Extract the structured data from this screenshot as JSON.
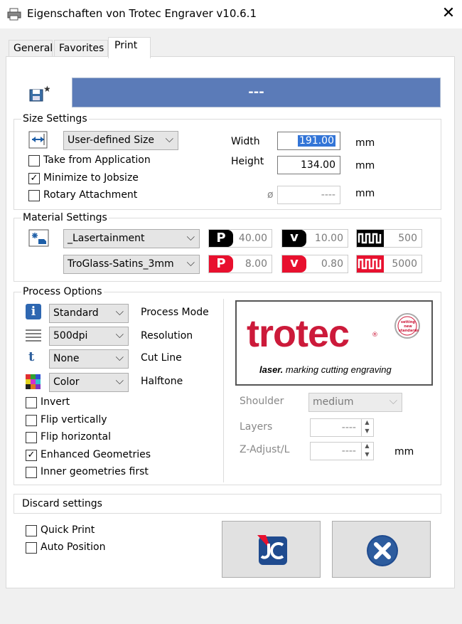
{
  "window": {
    "title": "Eigenschaften von Trotec Engraver v10.6.1",
    "close_glyph": "✕"
  },
  "tabs": [
    {
      "label": "General"
    },
    {
      "label": "Favorites"
    },
    {
      "label": "Print"
    }
  ],
  "job_bar": {
    "text": "---",
    "color": "#5b7bb8"
  },
  "size_settings": {
    "title": "Size Settings",
    "size_combo": "User-defined Size",
    "take_from_application": {
      "label": "Take from Application",
      "checked": false
    },
    "minimize_to_jobsize": {
      "label": "Minimize to Jobsize",
      "checked": true
    },
    "rotary_attachment": {
      "label": "Rotary Attachment",
      "checked": false
    },
    "width_label": "Width",
    "width_value": "191.00",
    "height_label": "Height",
    "height_value": "134.00",
    "diameter_symbol": "ø",
    "diameter_value": "----",
    "unit": "mm"
  },
  "material_settings": {
    "title": "Material Settings",
    "material_group": "_Lasertainment",
    "material": "TroGlass-Satins_3mm",
    "engrave": {
      "power": "40.00",
      "velocity": "10.00",
      "ppi": "500",
      "p_glyph": "P",
      "v_glyph": "v"
    },
    "cut": {
      "power": "8.00",
      "velocity": "0.80",
      "hz": "5000",
      "p_glyph": "P",
      "v_glyph": "v"
    }
  },
  "process_options": {
    "title": "Process Options",
    "process_mode": {
      "value": "Standard",
      "label": "Process Mode",
      "icon_glyph": "i"
    },
    "resolution": {
      "value": "500dpi",
      "label": "Resolution"
    },
    "cut_line": {
      "value": "None",
      "label": "Cut Line",
      "icon_glyph": "t"
    },
    "halftone": {
      "value": "Color",
      "label": "Halftone"
    },
    "invert": {
      "label": "Invert",
      "checked": false
    },
    "flip_vertically": {
      "label": "Flip vertically",
      "checked": false
    },
    "flip_horizontal": {
      "label": "Flip horizontal",
      "checked": false
    },
    "enhanced_geometries": {
      "label": "Enhanced Geometries",
      "checked": true
    },
    "inner_geometries_first": {
      "label": "Inner geometries first",
      "checked": false
    },
    "logo": {
      "brand": "trotec",
      "tagline_bold": "laser.",
      "tagline": " marking cutting engraving",
      "seal_text": "setting new standards",
      "reg_mark": "®"
    },
    "shoulder": {
      "label": "Shoulder",
      "value": "medium"
    },
    "layers": {
      "label": "Layers",
      "value": "----"
    },
    "z_adjust": {
      "label": "Z-Adjust/L",
      "value": "----",
      "unit": "mm"
    }
  },
  "discard_settings": {
    "label": "Discard settings"
  },
  "footer": {
    "quick_print": {
      "label": "Quick Print",
      "checked": false
    },
    "auto_position": {
      "label": "Auto Position",
      "checked": false
    }
  },
  "glyphs": {
    "check": "✓",
    "chevron": "⌵",
    "up": "▲",
    "down": "▼"
  },
  "colors": {
    "accent_blue": "#5b7bb8",
    "trotec_red": "#cc1a3a",
    "ok_blue": "#1f4b8f"
  }
}
